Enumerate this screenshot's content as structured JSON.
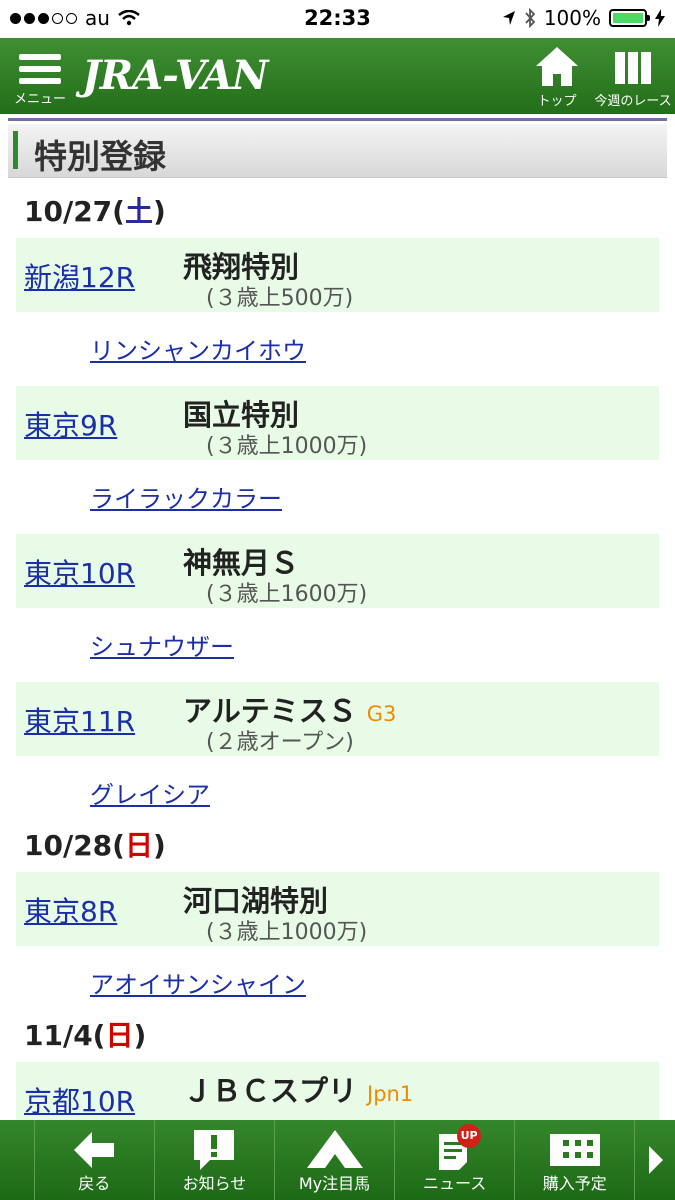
{
  "status_bar": {
    "carrier": "au",
    "time": "22:33",
    "battery": "100%"
  },
  "header": {
    "menu_label": "メニュー",
    "logo": "JRA-VAN",
    "top_label": "トップ",
    "week_label": "今週のレース"
  },
  "page_title": "特別登録",
  "days": [
    {
      "date": "10/27(",
      "weekday": "土",
      "close": ")",
      "races": [
        {
          "race_no": "新潟12R",
          "name": "飛翔特別",
          "grade": "",
          "condition": "(３歳上500万)",
          "horse": "リンシャンカイホウ"
        },
        {
          "race_no": "東京9R",
          "name": "国立特別",
          "grade": "",
          "condition": "(３歳上1000万)",
          "horse": "ライラックカラー"
        },
        {
          "race_no": "東京10R",
          "name": "神無月Ｓ",
          "grade": "",
          "condition": "(３歳上1600万)",
          "horse": "シュナウザー"
        },
        {
          "race_no": "東京11R",
          "name": "アルテミスＳ",
          "grade": "G3",
          "condition": "(２歳オープン)",
          "horse": "グレイシア"
        }
      ]
    },
    {
      "date": "10/28(",
      "weekday": "日",
      "close": ")",
      "races": [
        {
          "race_no": "東京8R",
          "name": "河口湖特別",
          "grade": "",
          "condition": "(３歳上1000万)",
          "horse": "アオイサンシャイン"
        }
      ]
    },
    {
      "date": "11/4(",
      "weekday": "日",
      "close": ")",
      "races": [
        {
          "race_no": "京都10R",
          "name": "ＪＢＣスプリ",
          "grade": "Jpn1",
          "condition": "",
          "horse": ""
        }
      ]
    }
  ],
  "tabbar": {
    "back": "戻る",
    "news_info": "お知らせ",
    "my_horse": "My注目馬",
    "news": "ニュース",
    "news_badge": "UP",
    "purchase": "購入予定"
  },
  "colors": {
    "header_green": "#2e7d22",
    "race_bg": "#e8fbe6",
    "link": "#1a2fa8",
    "grade": "#f08a00",
    "sunday": "#d40000",
    "saturday": "#2a2a9a"
  }
}
